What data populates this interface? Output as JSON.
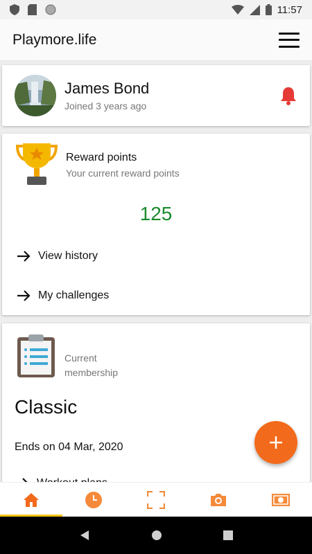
{
  "status_bar": {
    "time": "11:57"
  },
  "app_bar": {
    "title": "Playmore.life"
  },
  "profile": {
    "name": "James Bond",
    "joined": "Joined 3 years ago"
  },
  "reward": {
    "title": "Reward points",
    "subtitle": "Your current reward points",
    "points": "125",
    "links": {
      "history": "View history",
      "challenges": "My challenges"
    }
  },
  "membership": {
    "label": "Current membership",
    "plan": "Classic",
    "ends": "Ends on 04 Mar, 2020",
    "partial_link": "Workout plans"
  },
  "colors": {
    "accent": "#f26a1b",
    "points": "#1b8a2d",
    "bell": "#e53935",
    "nav_indicator": "#f5c518"
  },
  "bottom_nav": {
    "items": [
      "home-icon",
      "clock-icon",
      "scan-icon",
      "camera-icon",
      "money-icon"
    ],
    "active": "home-icon"
  }
}
